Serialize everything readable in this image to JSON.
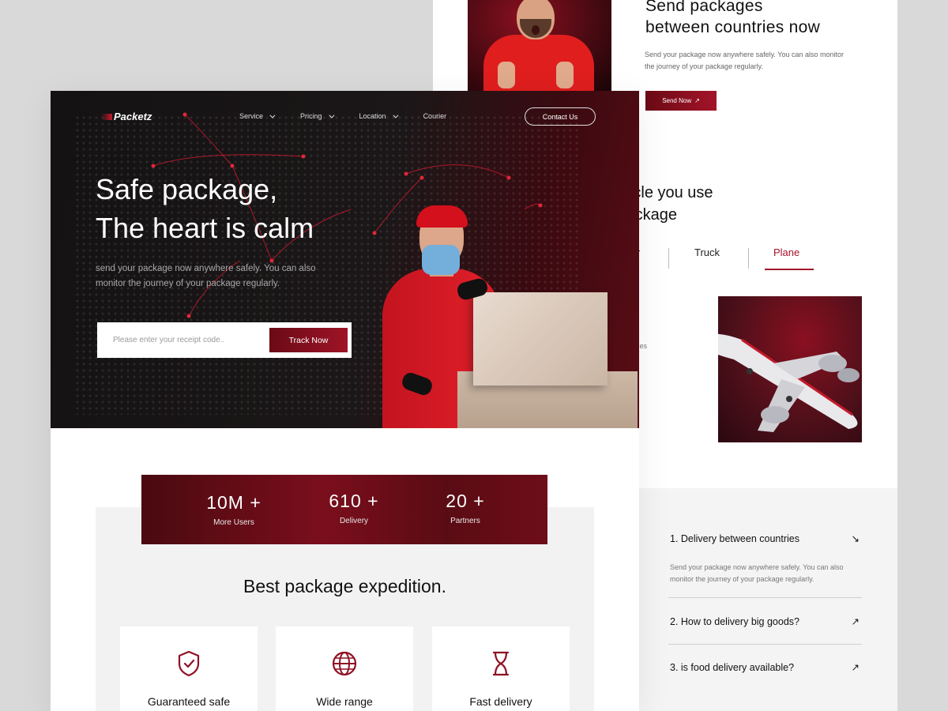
{
  "back": {
    "title_line1": "Send packages",
    "title_line2": "between countries now",
    "desc": "Send your package now anywhere safely. You can also monitor the journey of your package regularly.",
    "send_button": "Send Now",
    "vehicle_title_line1": "e vehicle you use",
    "vehicle_title_line2": "the package",
    "vehicle_tabs": [
      {
        "label": "r"
      },
      {
        "label": "Truck"
      },
      {
        "label": "Plane",
        "active": true
      }
    ],
    "side_text": "untries",
    "faq": [
      {
        "question": "1. Delivery between countries",
        "answer": "Send your package now anywhere safely. You can also monitor the journey of your package regularly.",
        "icon": "arrow-down-right-icon"
      },
      {
        "question": "2.  How to delivery big goods?",
        "icon": "arrow-up-right-icon"
      },
      {
        "question": "3.  is food delivery available?",
        "icon": "arrow-up-right-icon"
      }
    ]
  },
  "front": {
    "logo": "Packetz",
    "nav": [
      {
        "label": "Service",
        "has_dropdown": true
      },
      {
        "label": "Pricing",
        "has_dropdown": true
      },
      {
        "label": "Location",
        "has_dropdown": true
      },
      {
        "label": "Courier",
        "has_dropdown": false
      }
    ],
    "contact_button": "Contact Us",
    "hero_title_line1": "Safe package,",
    "hero_title_line2": "The heart is calm",
    "hero_desc": "send your package now anywhere safely. You can also monitor the journey of your package regularly.",
    "track": {
      "placeholder": "Please enter your receipt code..",
      "button": "Track Now"
    },
    "stats": [
      {
        "value": "10M +",
        "label": "More Users"
      },
      {
        "value": "610 +",
        "label": "Delivery"
      },
      {
        "value": "20 +",
        "label": "Partners"
      }
    ],
    "section_title": "Best package expedition.",
    "features": [
      {
        "label": "Guaranteed safe",
        "icon": "shield-check-icon"
      },
      {
        "label": "Wide range",
        "icon": "globe-icon"
      },
      {
        "label": "Fast delivery",
        "icon": "hourglass-icon"
      }
    ]
  },
  "colors": {
    "accent": "#a31428",
    "dark": "#141213",
    "background": "#d9d9d9"
  }
}
